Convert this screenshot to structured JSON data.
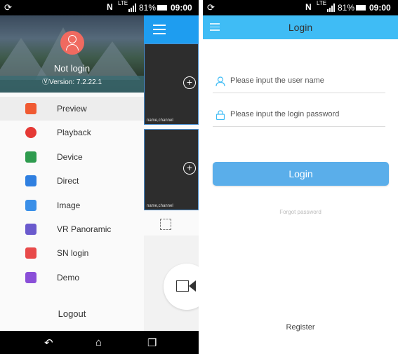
{
  "status_left": {
    "sync_icon": "sync-icon",
    "nfc": "N",
    "lte": "LTE",
    "battery_pct": "81%",
    "time": "09:00"
  },
  "status_right": {
    "sync_icon": "sync-icon",
    "nfc": "N",
    "lte": "LTE",
    "battery_pct": "81%",
    "time": "09:00"
  },
  "drawer": {
    "user_status": "Not login",
    "version": "Version: 7.2.22.1",
    "items": [
      {
        "label": "Preview",
        "icon": "video-camera-icon",
        "color": "#f05a32"
      },
      {
        "label": "Playback",
        "icon": "playback-clock-icon",
        "color": "#e53935"
      },
      {
        "label": "Device",
        "icon": "device-icon",
        "color": "#2e9b4e"
      },
      {
        "label": "Direct",
        "icon": "direct-link-icon",
        "color": "#2f7fe0"
      },
      {
        "label": "Image",
        "icon": "image-icon",
        "color": "#3a8fe8"
      },
      {
        "label": "VR Panoramic",
        "icon": "vr-panoramic-icon",
        "color": "#6a5acd"
      },
      {
        "label": "SN login",
        "icon": "sn-login-icon",
        "color": "#e84a4a"
      },
      {
        "label": "Demo",
        "icon": "demo-play-icon",
        "color": "#8a4fd8"
      }
    ],
    "logout": "Logout"
  },
  "preview": {
    "channel_1": "name,channel",
    "channel_2": "name,channel"
  },
  "login": {
    "title": "Login",
    "username_placeholder": "Please input the user name",
    "password_placeholder": "Please input the login password",
    "login_button": "Login",
    "forgot": "Forgot password",
    "register": "Register"
  },
  "colors": {
    "accent": "#1e9df0",
    "login_bar": "#3fbcf5",
    "login_button": "#5aaeea"
  }
}
